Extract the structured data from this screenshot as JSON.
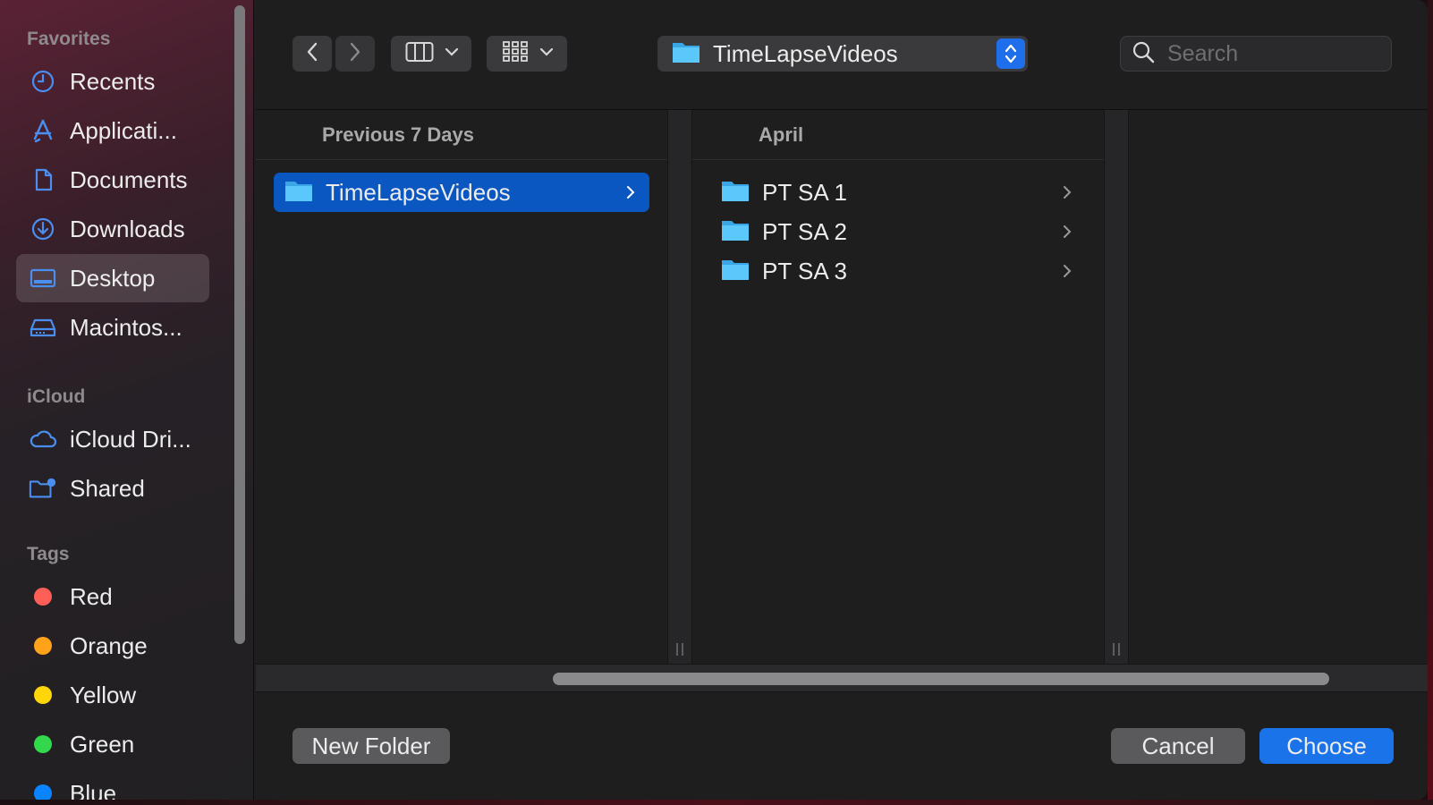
{
  "sidebar": {
    "favorites_header": "Favorites",
    "favorites": [
      {
        "label": "Recents",
        "icon": "clock-icon"
      },
      {
        "label": "Applicati...",
        "icon": "applications-icon"
      },
      {
        "label": "Documents",
        "icon": "document-icon"
      },
      {
        "label": "Downloads",
        "icon": "download-icon"
      },
      {
        "label": "Desktop",
        "icon": "desktop-icon",
        "selected": true
      },
      {
        "label": "Macintos...",
        "icon": "harddrive-icon"
      }
    ],
    "icloud_header": "iCloud",
    "icloud": [
      {
        "label": "iCloud Dri...",
        "icon": "cloud-icon"
      },
      {
        "label": "Shared",
        "icon": "shared-folder-icon"
      }
    ],
    "tags_header": "Tags",
    "tags": [
      {
        "label": "Red",
        "color": "#ff5f57"
      },
      {
        "label": "Orange",
        "color": "#ffa31a"
      },
      {
        "label": "Yellow",
        "color": "#ffd60a"
      },
      {
        "label": "Green",
        "color": "#32d74b"
      },
      {
        "label": "Blue",
        "color": "#0a84ff"
      }
    ]
  },
  "toolbar": {
    "path_label": "TimeLapseVideos",
    "search_placeholder": "Search"
  },
  "columns": {
    "col1_header": "Previous 7 Days",
    "col1_items": [
      {
        "label": "TimeLapseVideos",
        "selected": true
      }
    ],
    "col2_header": "April",
    "col2_items": [
      {
        "label": "PT SA 1"
      },
      {
        "label": "PT SA 2"
      },
      {
        "label": "PT SA 3"
      }
    ]
  },
  "footer": {
    "new_folder": "New Folder",
    "cancel": "Cancel",
    "choose": "Choose"
  },
  "colors": {
    "accent": "#1a73e8",
    "selection": "#0a57c2",
    "folder": "#5ac8fa"
  }
}
